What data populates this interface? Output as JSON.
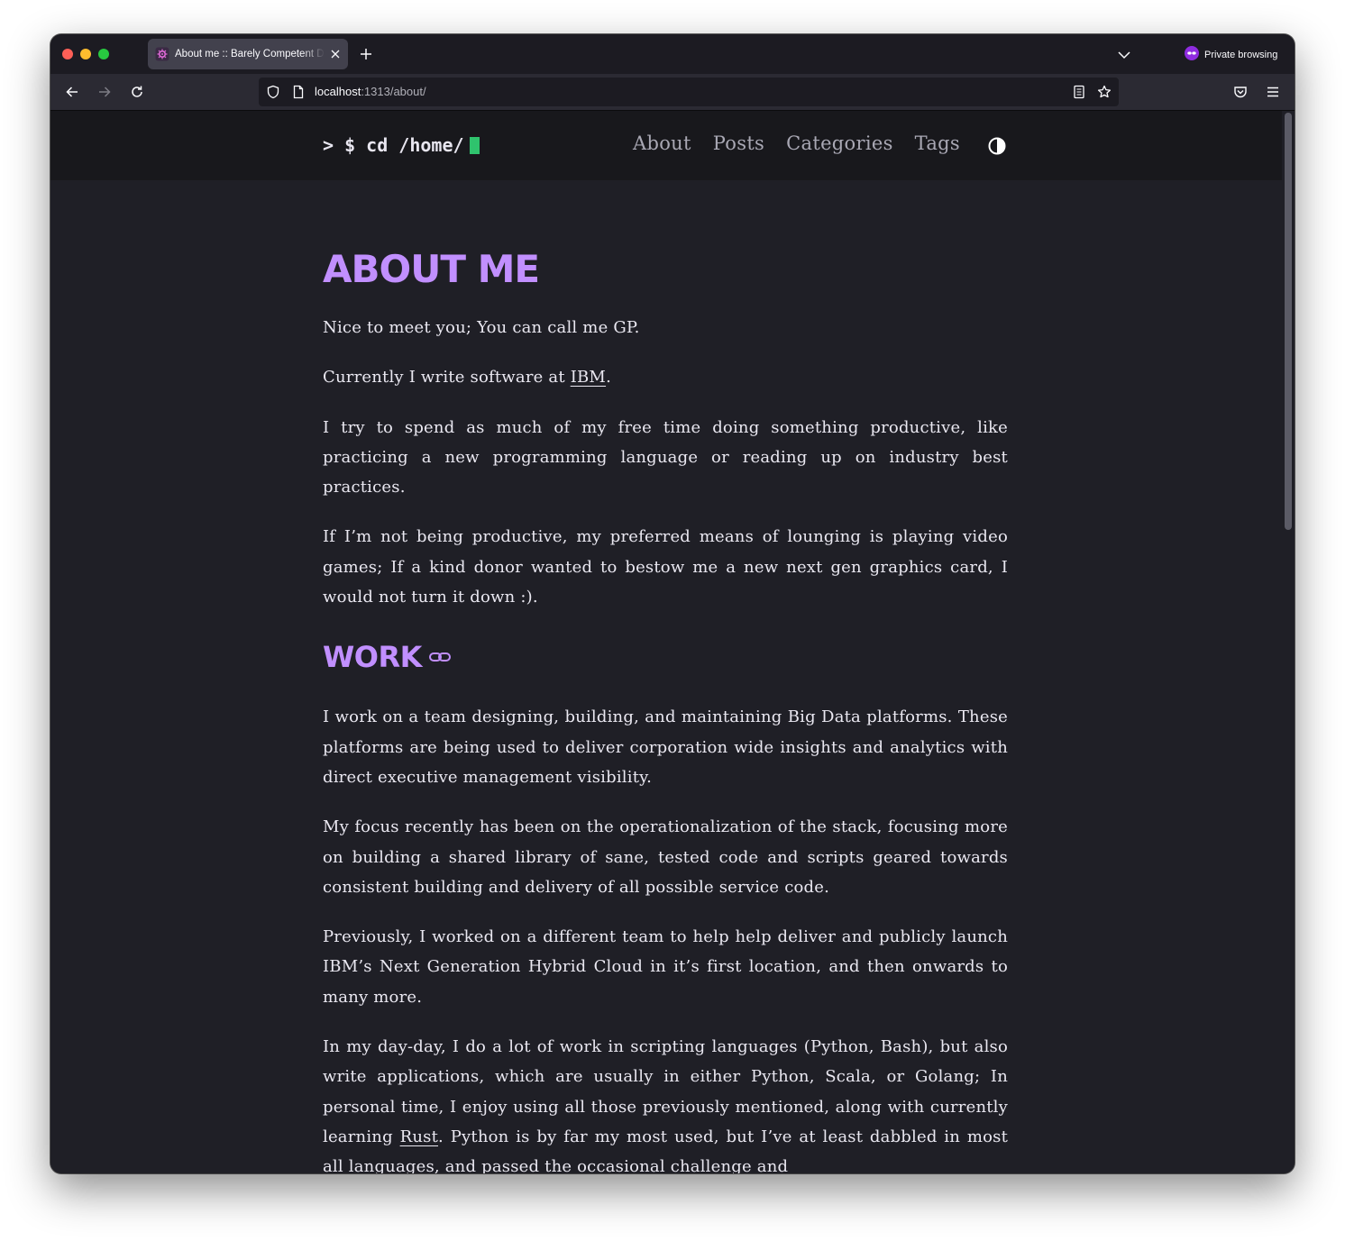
{
  "browser": {
    "tab_title": "About me :: Barely Competent Dev",
    "url_host": "localhost",
    "url_path": ":1313/about/",
    "private_label": "Private browsing"
  },
  "site": {
    "logo_text": "> $ cd /home/",
    "menu": [
      "About",
      "Posts",
      "Categories",
      "Tags"
    ],
    "accent_color": "#c18fff",
    "cursor_color": "#2fc36d"
  },
  "article": {
    "title": "About me",
    "intro": {
      "p1": "Nice to meet you; You can call me GP.",
      "p2_before": "Currently I write software at ",
      "p2_link": "IBM",
      "p2_after": ".",
      "p3": "I try to spend as much of my free time doing something productive, like practicing a new programming language or reading up on industry best practices.",
      "p4": "If I’m not being productive, my preferred means of lounging is playing video games; If a kind donor wanted to bestow me a new next gen graphics card, I would not turn it down :)."
    },
    "work": {
      "heading": "Work",
      "p1": "I work on a team designing, building, and maintaining Big Data platforms. These platforms are being used to deliver corporation wide insights and analytics with direct executive management visibility.",
      "p2": "My focus recently has been on the operationalization of the stack, focusing more on building a shared library of sane, tested code and scripts geared towards consistent building and delivery of all possible service code.",
      "p3": "Previously, I worked on a different team to help help deliver and publicly launch IBM’s Next Generation Hybrid Cloud in it’s first location, and then onwards to many more.",
      "p4_before": "In my day-day, I do a lot of work in scripting languages (Python, Bash), but also write applications, which are usually in either Python, Scala, or Golang; In personal time, I enjoy using all those previously mentioned, along with currently learning ",
      "p4_link": "Rust",
      "p4_after": ". Python is by far my most used, but I’ve at least dabbled in most all languages, and passed the occasional challenge and"
    }
  }
}
